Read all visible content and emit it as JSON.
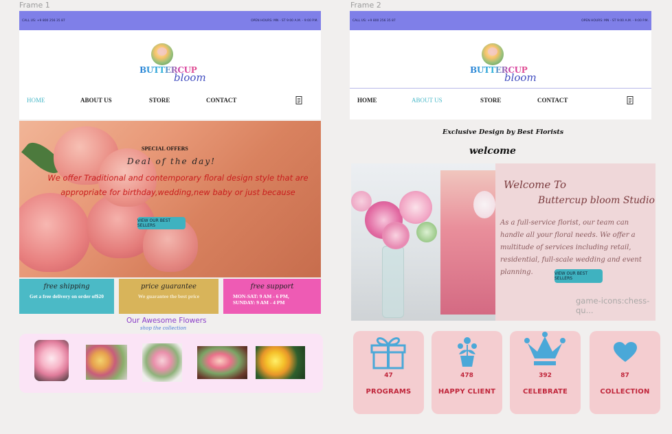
{
  "frames": {
    "frame1_label": "Frame 1",
    "frame2_label": "Frame 2"
  },
  "topbar": {
    "call": "CALL US: +9 800 256 35 87",
    "hours": "OPEN HOURS: MN - ST 9:00 A.M. - 9:00 P.M."
  },
  "logo": {
    "line1": "BUTTERCUP",
    "line2": "bloom"
  },
  "nav": {
    "home": "HOME",
    "about": "ABOUT US",
    "store": "STORE",
    "contact": "CONTACT"
  },
  "hero": {
    "title": "SPECIAL OFFERS",
    "subtitle": "Deal of the day!",
    "body": "We offer Traditional and contemporary floral design style that are appropriate for birthday,wedding,new baby or just because",
    "button": "VIEW OUR BEST SELLERS"
  },
  "features": [
    {
      "title": "free shipping",
      "desc": "Get a free delivery on order of$20",
      "color": "#4bbac6"
    },
    {
      "title": "price guarantee",
      "desc": "We guarantee the best price",
      "color": "#d8b45a"
    },
    {
      "title": "free support",
      "desc": "MON-SAT: 9 AM - 6 PM, SUNDAY: 9 AM - 4 PM",
      "color": "#ee5bb4"
    }
  ],
  "collection": {
    "title": "Our Awesome Flowers",
    "subtitle": "shop the collection"
  },
  "frame2": {
    "tagline": "Exclusive Design by Best Florists",
    "welcome": "welcome",
    "heading1": "Welcome To",
    "heading2": "Buttercup bloom Studio",
    "body": "As a full-service florist, our team can handle all your floral needs. We offer a multitude of services including retail, residential, full-scale wedding and event planning.",
    "button": "VIEW OUR BEST SELLERS",
    "watermark": "game-icons:chess-qu..."
  },
  "stats": [
    {
      "value": "47",
      "label": "PROGRAMS",
      "icon": "gift-icon"
    },
    {
      "value": "478",
      "label": "HAPPY CLIENT",
      "icon": "flower-pot-icon"
    },
    {
      "value": "392",
      "label": "CELEBRATE",
      "icon": "crown-icon"
    },
    {
      "value": "87",
      "label": "COLLECTION",
      "icon": "heart-icon"
    }
  ],
  "colors": {
    "topbar": "#7f7fe8",
    "accent_teal": "#49b8c8",
    "stat_text": "#c0263b",
    "stat_icon": "#4aa8d8"
  }
}
